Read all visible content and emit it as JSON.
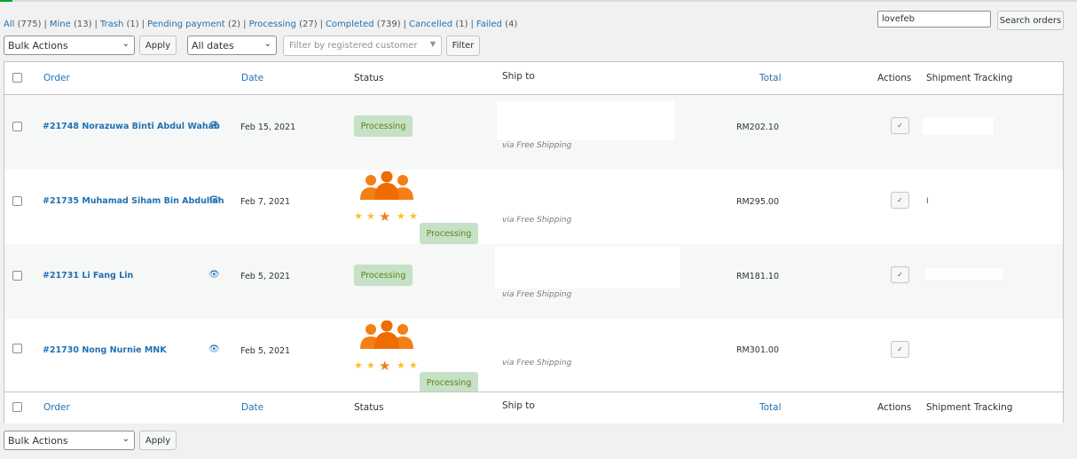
{
  "filters": {
    "links": [
      {
        "label": "All",
        "count": "(775)"
      },
      {
        "label": "Mine",
        "count": "(13)"
      },
      {
        "label": "Trash",
        "count": "(1)"
      },
      {
        "label": "Pending payment",
        "count": "(2)"
      },
      {
        "label": "Processing",
        "count": "(27)"
      },
      {
        "label": "Completed",
        "count": "(739)"
      },
      {
        "label": "Cancelled",
        "count": "(1)"
      },
      {
        "label": "Failed",
        "count": "(4)"
      }
    ],
    "separator": "|"
  },
  "search": {
    "value": "lovefeb",
    "button_label": "Search orders"
  },
  "tablenav_top": {
    "bulk_actions": "Bulk Actions",
    "apply_label": "Apply",
    "date_filter": "All dates",
    "customer_placeholder": "Filter by registered customer",
    "filter_label": "Filter"
  },
  "tablenav_bottom": {
    "bulk_actions": "Bulk Actions",
    "apply_label": "Apply"
  },
  "columns": {
    "order": "Order",
    "date": "Date",
    "status": "Status",
    "ship_to": "Ship to",
    "total": "Total",
    "actions": "Actions",
    "tracking": "Shipment Tracking"
  },
  "orders": [
    {
      "order": "#21748 Norazuwa Binti Abdul Wahab",
      "date": "Feb 15, 2021",
      "status": "Processing",
      "shipping": "via Free Shipping",
      "total": "RM202.10",
      "action": "✓",
      "tracking": ""
    },
    {
      "order": "#21735 Muhamad Siham Bin Abdullah",
      "date": "Feb 7, 2021",
      "status": "Processing",
      "shipping": "via Free Shipping",
      "total": "RM295.00",
      "action": "✓",
      "tracking": "I"
    },
    {
      "order": "#21731 Li Fang Lin",
      "date": "Feb 5, 2021",
      "status": "Processing",
      "shipping": "via Free Shipping",
      "total": "RM181.10",
      "action": "✓",
      "tracking": ""
    },
    {
      "order": "#21730 Nong Nurnie MNK",
      "date": "Feb 5, 2021",
      "status": "Processing",
      "shipping": "via Free Shipping",
      "total": "RM301.00",
      "action": "✓",
      "tracking": ""
    }
  ],
  "colors": {
    "link": "#2271b1",
    "status_bg": "#c6e1c6",
    "status_text": "#5b841b",
    "alt_row": "#f6f7f7",
    "badge_orange": "#f57f17",
    "badge_star": "#fbc02d"
  },
  "icons": {
    "preview": "eye-icon",
    "action": "check-icon",
    "select": "chevron-down-icon",
    "badge": "customer-group-rating-icon"
  }
}
